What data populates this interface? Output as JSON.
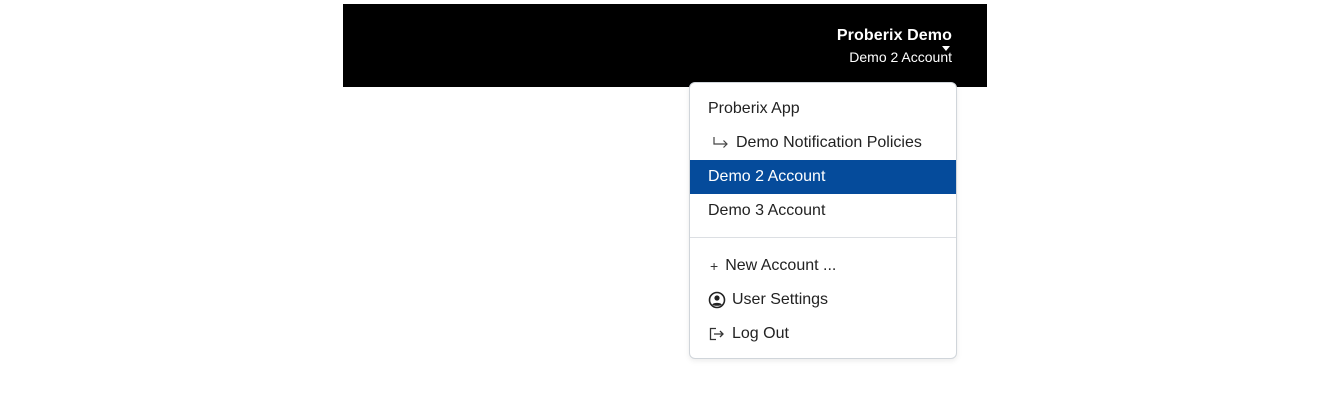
{
  "header": {
    "user_name": "Proberix Demo",
    "account_name": "Demo 2 Account"
  },
  "menu": {
    "items": [
      {
        "label": "Proberix App"
      },
      {
        "label": "Demo Notification Policies",
        "icon": "return-arrow-icon"
      },
      {
        "label": "Demo 2 Account",
        "active": true
      },
      {
        "label": "Demo 3 Account"
      }
    ],
    "actions": [
      {
        "label": "New Account ...",
        "icon": "plus-icon"
      },
      {
        "label": "User Settings",
        "icon": "user-circle-icon"
      },
      {
        "label": "Log Out",
        "icon": "logout-icon"
      }
    ]
  },
  "colors": {
    "topbar": "#000000",
    "active": "#054b9b"
  }
}
